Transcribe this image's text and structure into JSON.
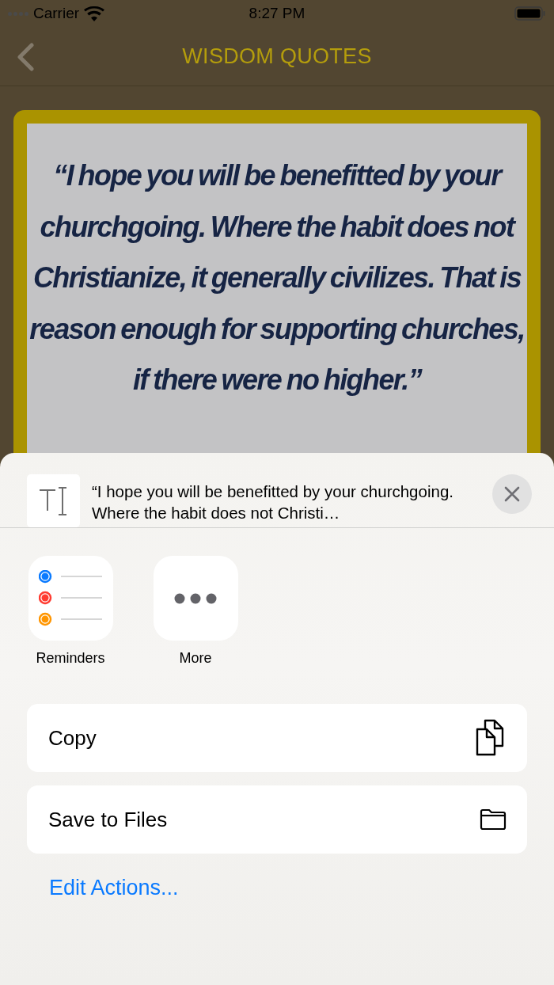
{
  "status_bar": {
    "carrier": "Carrier",
    "time": "8:27 PM"
  },
  "nav_bar": {
    "title": "WISDOM QUOTES"
  },
  "quote_card": {
    "text": "“I hope you will be benefitted by your churchgoing. Where the habit does not Christianize, it generally civilizes. That is reason enough for supporting churches, if there were no higher.”"
  },
  "share_sheet": {
    "preview_text": "“I hope you will be benefitted by your churchgoing. Where the habit does not Christi…",
    "apps": [
      {
        "kind": "reminders",
        "label": "Reminders"
      },
      {
        "kind": "more",
        "label": "More"
      }
    ],
    "actions": [
      {
        "kind": "copy",
        "label": "Copy"
      },
      {
        "kind": "files",
        "label": "Save to Files"
      }
    ],
    "edit_link": "Edit Actions..."
  }
}
